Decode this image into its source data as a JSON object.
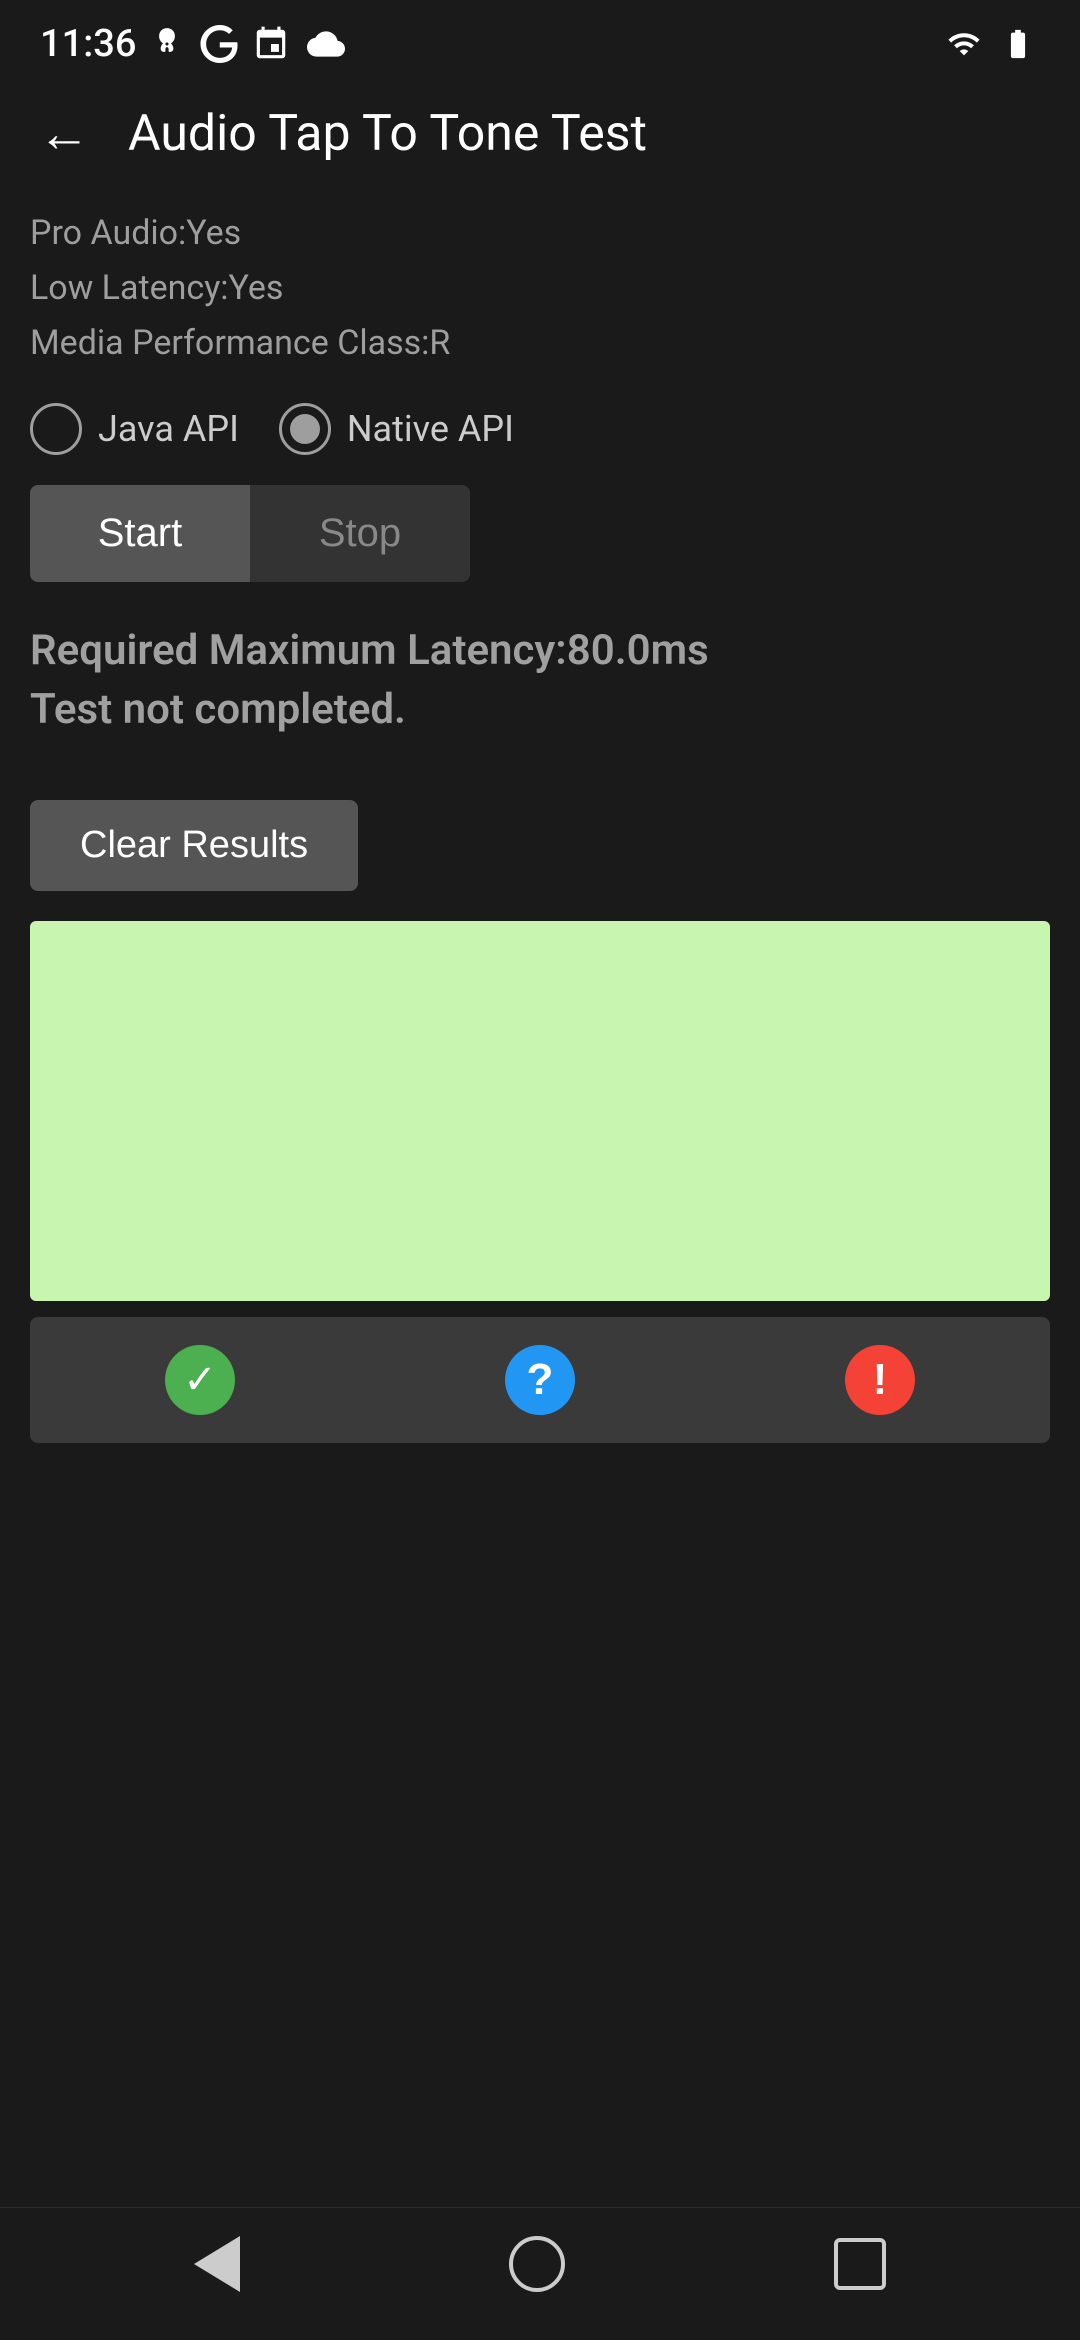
{
  "statusBar": {
    "time": "11:36"
  },
  "header": {
    "title": "Audio Tap To Tone Test",
    "backLabel": "←"
  },
  "info": {
    "proAudio": "Pro Audio:Yes",
    "lowLatency": "Low Latency:Yes",
    "mediaPerformance": "Media Performance Class:R"
  },
  "radioGroup": {
    "options": [
      {
        "id": "java",
        "label": "Java API",
        "selected": false
      },
      {
        "id": "native",
        "label": "Native API",
        "selected": true
      }
    ]
  },
  "buttons": {
    "start": "Start",
    "stop": "Stop"
  },
  "statusText": {
    "line1": "Required Maximum Latency:80.0ms",
    "line2": "Test not completed."
  },
  "clearResults": {
    "label": "Clear Results"
  },
  "bottomIcons": {
    "checkIcon": "✓",
    "questionIcon": "?",
    "warningIcon": "!"
  },
  "navBar": {
    "back": "back",
    "home": "home",
    "recents": "recents"
  }
}
